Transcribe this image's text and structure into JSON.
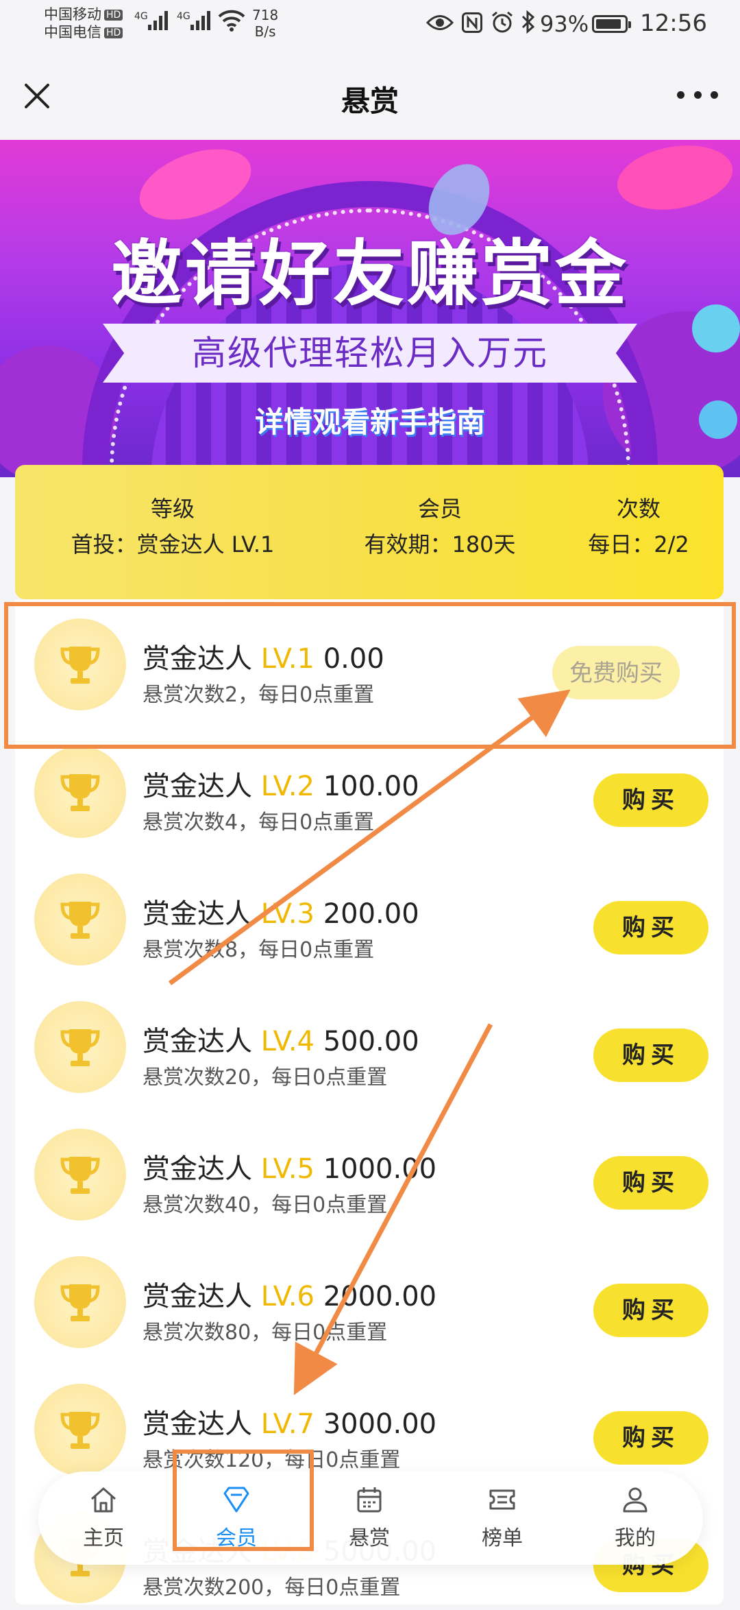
{
  "status_bar": {
    "carrier1": "中国移动",
    "carrier2": "中国电信",
    "hd": "HD",
    "net1": "4G",
    "net2": "4G",
    "speed_value": "718",
    "speed_unit": "B/s",
    "battery": "93%",
    "battery_level": 0.93,
    "time": "12:56"
  },
  "nav": {
    "title": "悬赏"
  },
  "banner": {
    "title": "邀请好友赚赏金",
    "ribbon": "高级代理轻松月入万元",
    "subtitle": "详情观看新手指南"
  },
  "level_card": {
    "col1_header": "等级",
    "col1_value": "首投：赏金达人 LV.1",
    "col2_header": "会员",
    "col2_value": "有效期：180天",
    "col3_header": "次数",
    "col3_value": "每日：2/2"
  },
  "items": [
    {
      "name": "赏金达人 ",
      "lv": "LV.1",
      "price": " 0.00",
      "desc": "悬赏次数2，每日0点重置",
      "button": "免费购买"
    },
    {
      "name": "赏金达人 ",
      "lv": "LV.2",
      "price": " 100.00",
      "desc": "悬赏次数4，每日0点重置",
      "button": "购买"
    },
    {
      "name": "赏金达人 ",
      "lv": "LV.3",
      "price": " 200.00",
      "desc": "悬赏次数8，每日0点重置",
      "button": "购买"
    },
    {
      "name": "赏金达人 ",
      "lv": "LV.4",
      "price": " 500.00",
      "desc": "悬赏次数20，每日0点重置",
      "button": "购买"
    },
    {
      "name": "赏金达人 ",
      "lv": "LV.5",
      "price": " 1000.00",
      "desc": "悬赏次数40，每日0点重置",
      "button": "购买"
    },
    {
      "name": "赏金达人 ",
      "lv": "LV.6",
      "price": " 2000.00",
      "desc": "悬赏次数80，每日0点重置",
      "button": "购买"
    },
    {
      "name": "赏金达人 ",
      "lv": "LV.7",
      "price": " 3000.00",
      "desc": "悬赏次数120，每日0点重置",
      "button": "购买"
    },
    {
      "name": "赏金达人 ",
      "lv": "LV.8",
      "price": " 5000.00",
      "desc": "悬赏次数200，每日0点重置",
      "button": "购买"
    }
  ],
  "tabbar": {
    "tabs": [
      {
        "label": "主页",
        "icon": "home-icon"
      },
      {
        "label": "会员",
        "icon": "diamond-icon"
      },
      {
        "label": "悬赏",
        "icon": "calendar-icon"
      },
      {
        "label": "榜单",
        "icon": "ticket-icon"
      },
      {
        "label": "我的",
        "icon": "user-icon"
      }
    ],
    "active_index": 1
  },
  "colors": {
    "accent_yellow": "#f8e12e",
    "level_text": "#f0b800",
    "tab_active": "#1a8ef5",
    "annotation": "#f08a45"
  }
}
